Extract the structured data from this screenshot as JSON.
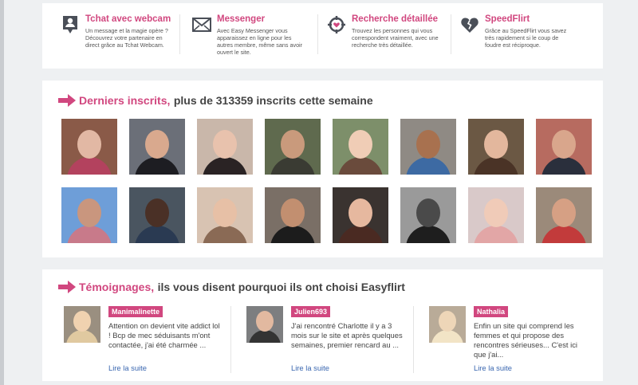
{
  "features": [
    {
      "icon": "webcam-chat-icon",
      "title": "Tchat avec webcam",
      "text": "Un message et la magie opère ? Découvrez votre partenaire en direct grâce au Tchat Webcam."
    },
    {
      "icon": "envelope-icon",
      "title": "Messenger",
      "text": "Avec Easy Messenger vous apparaissez en ligne pour les autres membre, même sans avoir ouvert le site."
    },
    {
      "icon": "target-heart-icon",
      "title": "Recherche détaillée",
      "text": "Trouvez les personnes qui vous correspondent vraiment, avec une recherche très détaillée."
    },
    {
      "icon": "broken-heart-icon",
      "title": "SpeedFlirt",
      "text": "Grâce au SpeedFlirt vous savez très rapidement si le coup de foudre est réciproque."
    }
  ],
  "members": {
    "title_highlight": "Derniers inscrits,",
    "title_rest": "plus de 313359 inscrits cette semaine",
    "photos": [
      {
        "bg": "#8a5a48",
        "skin": "#e2b8a4",
        "clothes": "#b3425e"
      },
      {
        "bg": "#6b6f78",
        "skin": "#d9a98e",
        "clothes": "#1d1d22"
      },
      {
        "bg": "#c9b7aa",
        "skin": "#e8c2ad",
        "clothes": "#2a2324"
      },
      {
        "bg": "#5f6a4e",
        "skin": "#c99a7c",
        "clothes": "#3a3b33"
      },
      {
        "bg": "#7d8f6a",
        "skin": "#f0cdb6",
        "clothes": "#6a4b3c"
      },
      {
        "bg": "#8f8a84",
        "skin": "#a8714f",
        "clothes": "#3d6aa3"
      },
      {
        "bg": "#6b5844",
        "skin": "#e3b79d",
        "clothes": "#4a3326"
      },
      {
        "bg": "#b76b60",
        "skin": "#d9a68c",
        "clothes": "#2a2f3c"
      },
      {
        "bg": "#6e9ed8",
        "skin": "#c9967e",
        "clothes": "#c87a8a"
      },
      {
        "bg": "#4a5560",
        "skin": "#4a3026",
        "clothes": "#2a3a52"
      },
      {
        "bg": "#d8c3b2",
        "skin": "#e7c0a6",
        "clothes": "#8a6a55"
      },
      {
        "bg": "#7a6f66",
        "skin": "#c28f70",
        "clothes": "#1c1c1c"
      },
      {
        "bg": "#3a3330",
        "skin": "#e6b89f",
        "clothes": "#4a2a22"
      },
      {
        "bg": "#9a9a9a",
        "skin": "#4a4a4a",
        "clothes": "#1e1e1e"
      },
      {
        "bg": "#d9c9c9",
        "skin": "#f0cbb8",
        "clothes": "#e2a6a6"
      },
      {
        "bg": "#9b8a7a",
        "skin": "#d6a084",
        "clothes": "#c23b3b"
      }
    ]
  },
  "testimonials": {
    "title_highlight": "Témoignages,",
    "title_rest": "ils vous disent pourquoi ils ont choisi Easyflirt",
    "items": [
      {
        "user": "Manimalinette",
        "quote": "Attention on devient vite addict lol ! Bcp de mec séduisants m'ont contactée, j'ai été charmée ...",
        "link": "Lire la suite",
        "bg": "#9a8f80",
        "skin": "#f0d2b0",
        "clothes": "#e0c9a0"
      },
      {
        "user": "Julien693",
        "quote": "J'ai rencontré Charlotte il y a 3 mois sur le site et après quelques semaines, premier rencard au ...",
        "link": "Lire la suite",
        "bg": "#7d7e80",
        "skin": "#e2b9a0",
        "clothes": "#333333"
      },
      {
        "user": "Nathalia",
        "quote": "Enfin un site qui comprend les femmes et qui propose des rencontres sérieuses... C'est ici que j'ai...",
        "link": "Lire la suite",
        "bg": "#b9ab98",
        "skin": "#eed6b8",
        "clothes": "#f2e4c6"
      }
    ]
  },
  "colors": {
    "accent": "#d1477f",
    "link": "#3a67b0",
    "text": "#444444",
    "background": "#eef0f2"
  }
}
